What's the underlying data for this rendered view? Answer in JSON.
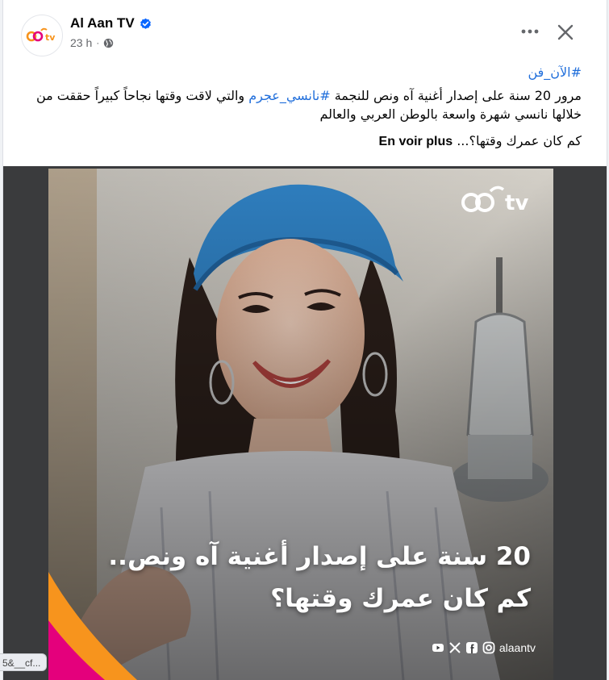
{
  "post": {
    "page_name": "Al Aan TV",
    "time": "23 h",
    "hashtag_top": "#الآن_فن",
    "line1_before": "مرور 20 سنة على إصدار أغنية آه ونص للنجمة ",
    "line1_hashtag": "#نانسي_عجرم",
    "line1_after": " والتي لاقت وقتها نجاحاً كبيراً حققت من خلالها نانسي شهرة واسعة بالوطن العربي والعالم",
    "question": "كم كان عمرك وقتها؟...",
    "see_more": "En voir plus"
  },
  "image": {
    "brand_logo_text": "tv",
    "overlay_line1": "20 سنة على إصدار أغنية آه ونص..",
    "overlay_line2": "كم كان عمرك وقتها؟",
    "handle": "alaantv",
    "social_icons": [
      "youtube-icon",
      "x-icon",
      "facebook-icon",
      "instagram-icon"
    ]
  },
  "url_hint": "5&__cf...",
  "colors": {
    "link": "#216fdb",
    "verified": "#0866ff",
    "headscarf": "#2f7fc0",
    "brand_orange": "#f7941d",
    "brand_pink": "#e4007c"
  }
}
